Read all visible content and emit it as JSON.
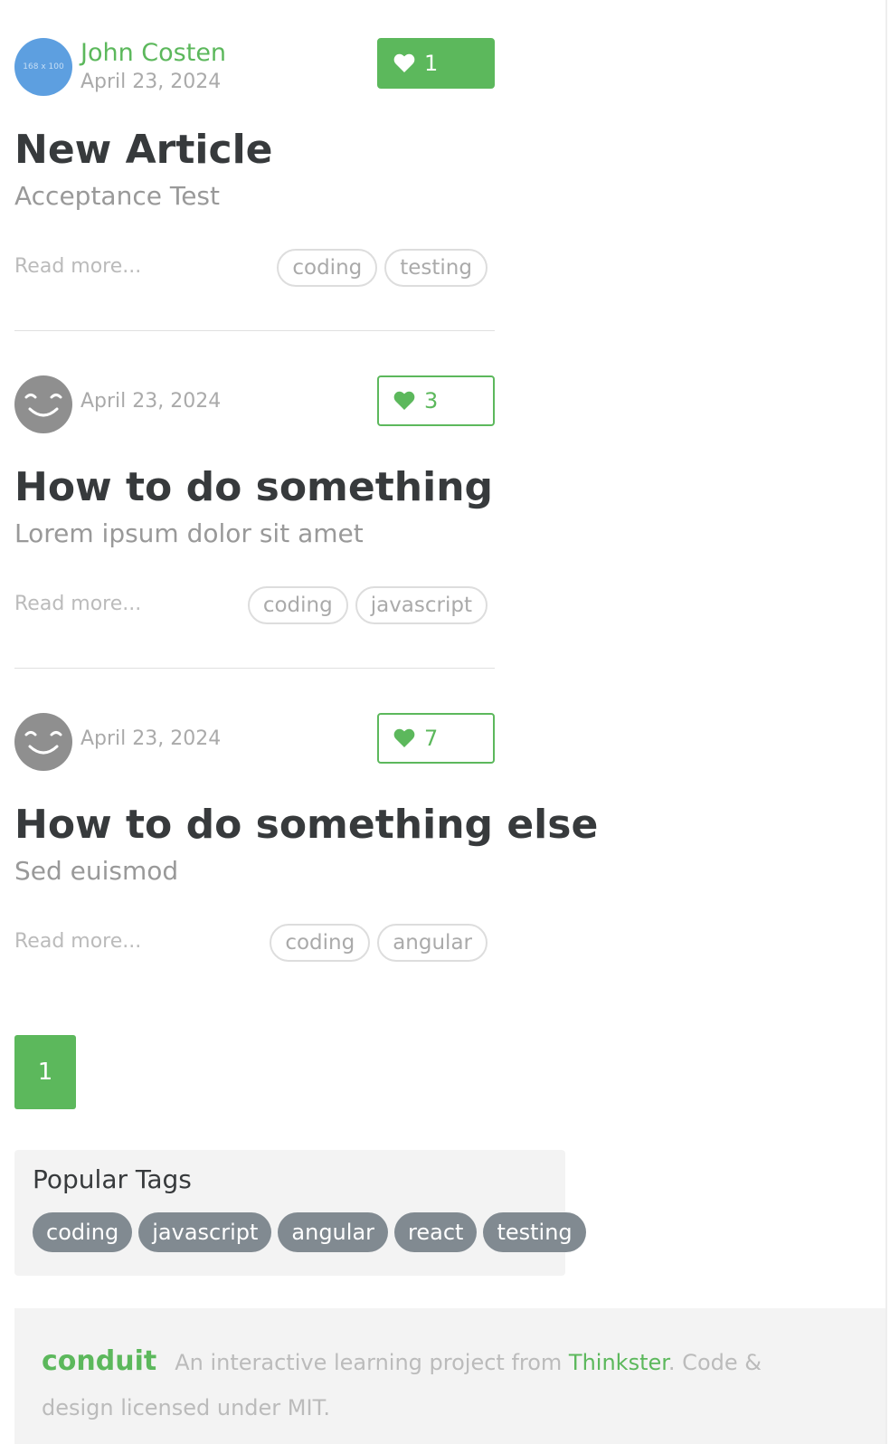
{
  "articles": [
    {
      "author": "John Costen",
      "avatar_text": "168 x 100",
      "date": "April 23, 2024",
      "favorites": "1",
      "title": "New Article",
      "description": "Acceptance Test",
      "read_more": "Read more...",
      "tags": [
        "coding",
        "testing"
      ]
    },
    {
      "author": "",
      "date": "April 23, 2024",
      "favorites": "3",
      "title": "How to do something",
      "description": "Lorem ipsum dolor sit amet",
      "read_more": "Read more...",
      "tags": [
        "coding",
        "javascript"
      ]
    },
    {
      "author": "",
      "date": "April 23, 2024",
      "favorites": "7",
      "title": "How to do something else",
      "description": "Sed euismod",
      "read_more": "Read more...",
      "tags": [
        "coding",
        "angular"
      ]
    }
  ],
  "pagination": {
    "current_page": "1"
  },
  "sidebar": {
    "title": "Popular Tags",
    "tags": [
      "coding",
      "javascript",
      "angular",
      "react",
      "testing"
    ]
  },
  "footer": {
    "logo": "conduit",
    "text_before": "An interactive learning project from ",
    "link_text": "Thinkster",
    "text_after": ". Code & design licensed under MIT."
  },
  "colors": {
    "accent": "#5cb85c",
    "tag_pill": "#818a91",
    "avatar_placeholder": "#5d9fe0",
    "avatar_default": "#8f8f8f"
  },
  "icons": {
    "favorite": "heart-icon",
    "default_avatar": "smiley-face-icon"
  }
}
